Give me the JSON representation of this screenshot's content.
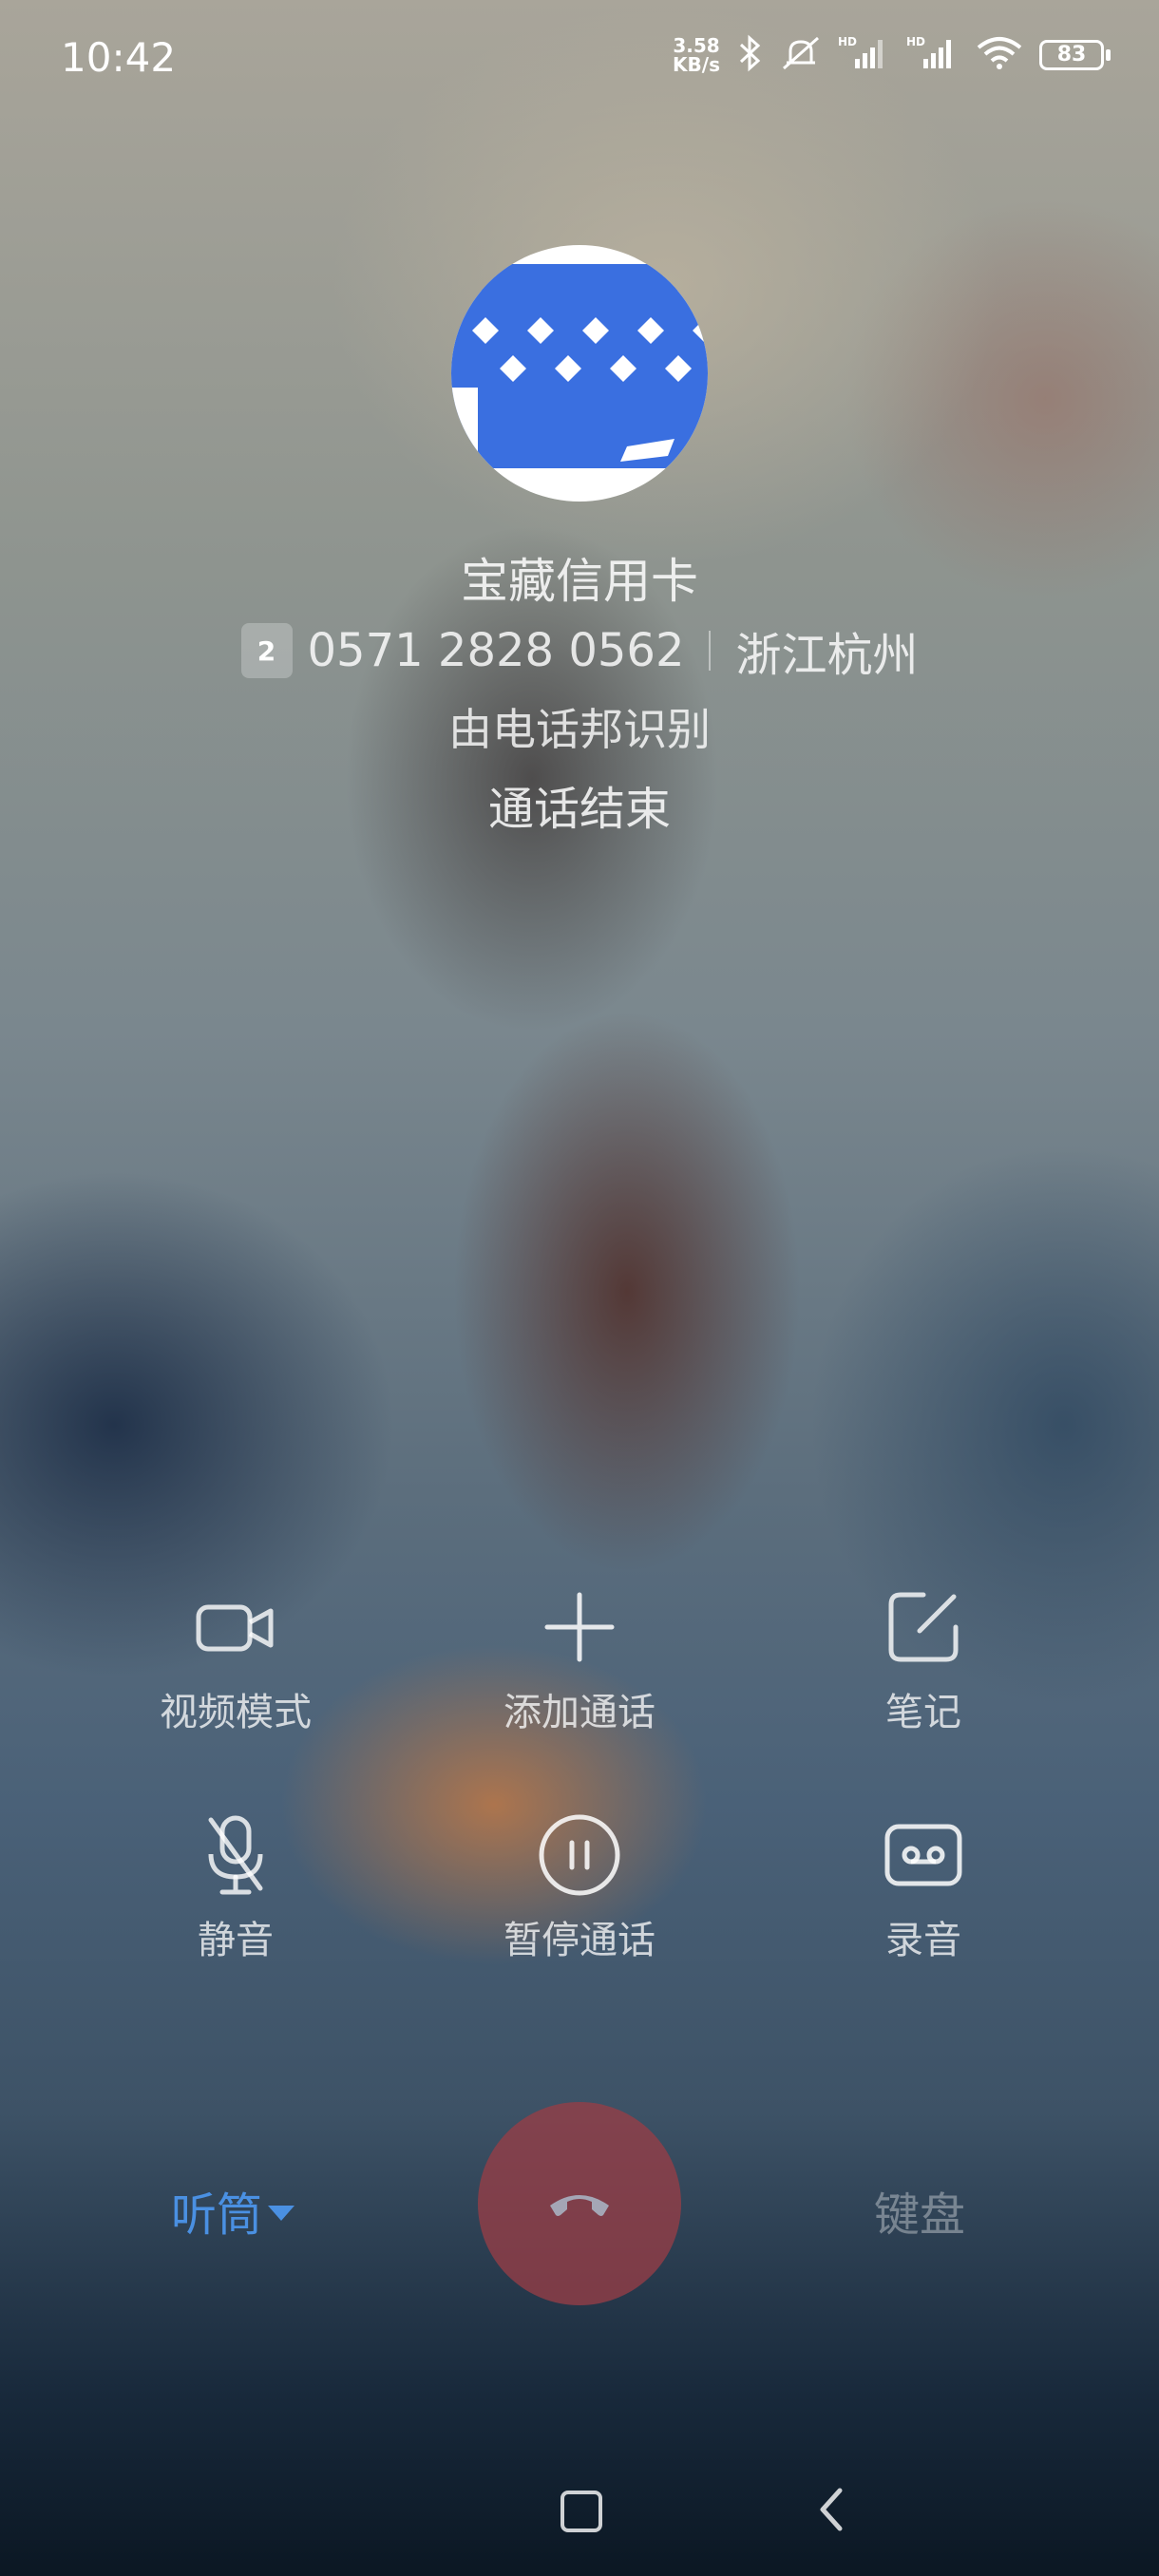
{
  "status_bar": {
    "time": "10:42",
    "net_speed_value": "3.58",
    "net_speed_unit": "KB/s",
    "signal_label_1": "HD",
    "signal_label_2": "HD",
    "battery": "83",
    "icons": [
      "bluetooth-icon",
      "silent-bell-icon",
      "signal-1-icon",
      "signal-2-icon",
      "wifi-icon",
      "battery-icon"
    ]
  },
  "caller": {
    "name": "宝藏信用卡",
    "sim_slot": "2",
    "number": "0571 2828 0562",
    "location": "浙江杭州",
    "identified_by": "由电话邦识别",
    "status": "通话结束",
    "avatar_color": "#3a6fe0"
  },
  "actions": [
    {
      "label": "视频模式",
      "icon": "video-camera-icon"
    },
    {
      "label": "添加通话",
      "icon": "plus-icon"
    },
    {
      "label": "笔记",
      "icon": "note-edit-icon"
    },
    {
      "label": "静音",
      "icon": "microphone-muted-icon"
    },
    {
      "label": "暂停通话",
      "icon": "pause-circle-icon"
    },
    {
      "label": "录音",
      "icon": "voicemail-record-icon"
    }
  ],
  "bottom": {
    "audio_route": "听筒",
    "keypad": "键盘",
    "hangup_icon": "phone-hangup-icon",
    "accent": "#4a90e2",
    "hangup_color": "#963e46"
  },
  "nav": {
    "icons": [
      "home-square-icon",
      "back-chevron-icon"
    ]
  }
}
